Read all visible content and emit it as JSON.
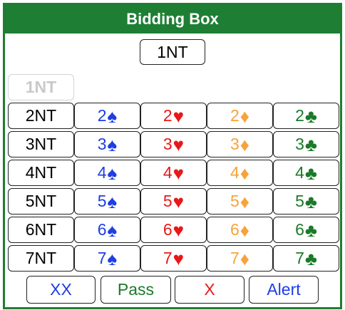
{
  "title": "Bidding Box",
  "last_bid": "1NT",
  "disabled_bid": "1NT",
  "grid": [
    [
      "2NT",
      "2",
      "2",
      "2",
      "2"
    ],
    [
      "3NT",
      "3",
      "3",
      "3",
      "3"
    ],
    [
      "4NT",
      "4",
      "4",
      "4",
      "4"
    ],
    [
      "5NT",
      "5",
      "5",
      "5",
      "5"
    ],
    [
      "6NT",
      "6",
      "6",
      "6",
      "6"
    ],
    [
      "7NT",
      "7",
      "7",
      "7",
      "7"
    ]
  ],
  "suits": {
    "spade": "♠",
    "heart": "♥",
    "diamond": "♦",
    "club": "♣"
  },
  "actions": {
    "redouble": "XX",
    "pass": "Pass",
    "double": "X",
    "alert": "Alert"
  },
  "colors": {
    "header": "#1e7f34",
    "spade": "#1e3de5",
    "heart": "#e81818",
    "diamond": "#f7a33a",
    "club": "#1b7a2a",
    "disabled": "#c9c9c9"
  }
}
